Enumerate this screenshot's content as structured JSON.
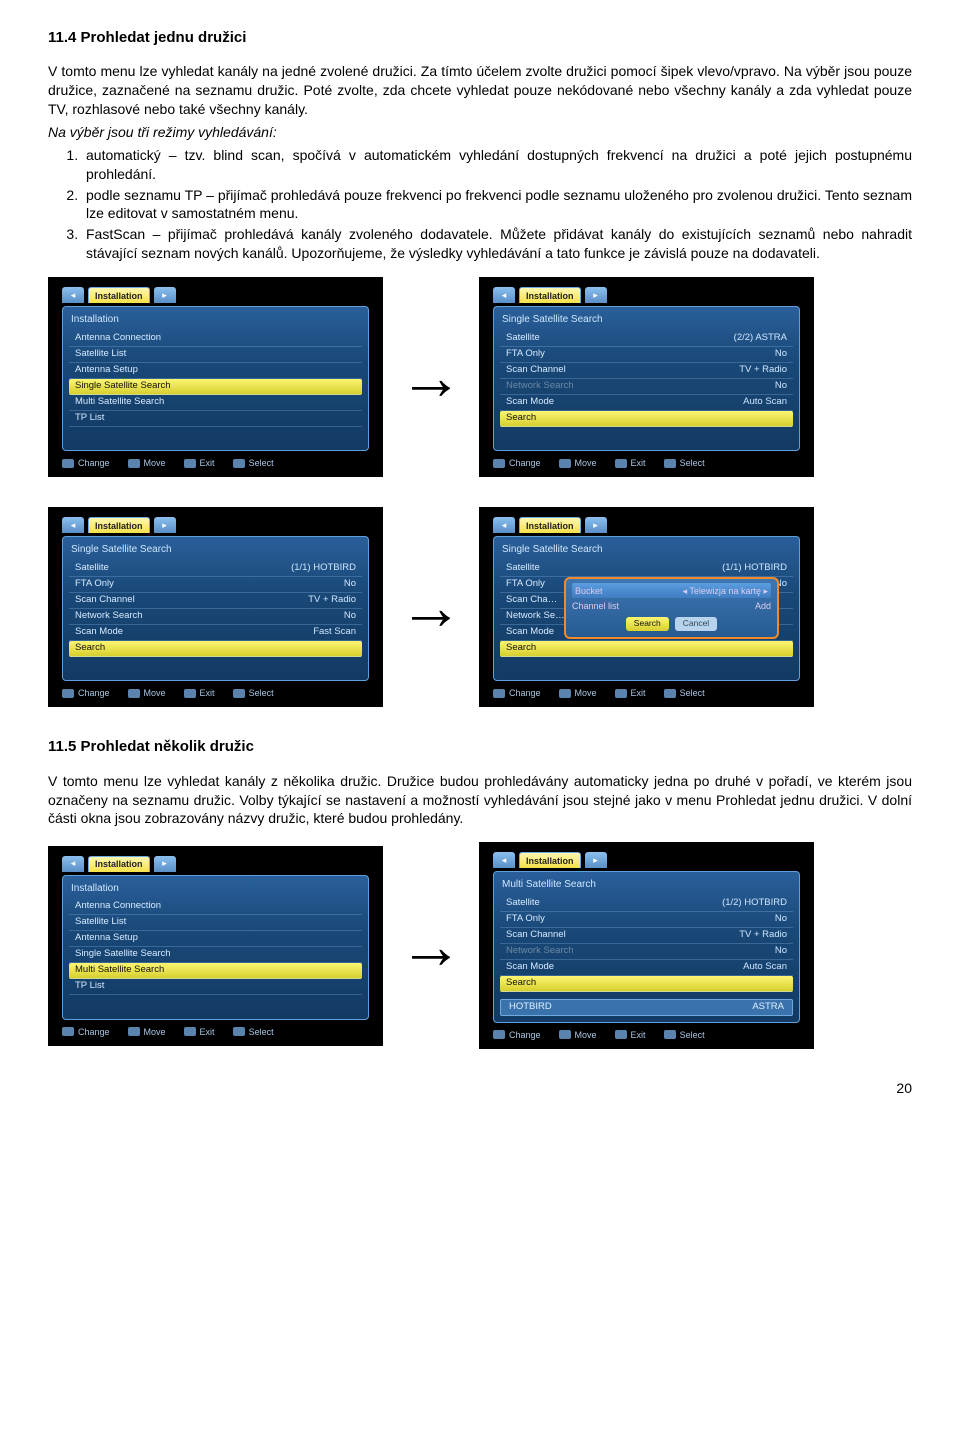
{
  "section1": {
    "heading": "11.4 Prohledat jednu družici",
    "p1": "V tomto menu lze vyhledat kanály na jedné zvolené družici. Za tímto účelem zvolte družici pomocí šipek vlevo/vpravo. Na výběr jsou pouze družice, zaznačené na seznamu družic. Poté zvolte, zda chcete vyhledat pouze nekódované nebo všechny kanály a zda vyhledat pouze TV, rozhlasové nebo také všechny kanály.",
    "modes_intro": "Na výběr jsou tři režimy vyhledávání:",
    "modes": [
      "automatický – tzv. blind scan, spočívá v automatickém vyhledání dostupných frekvencí na družici a poté jejich postupnému prohledání.",
      "podle seznamu TP – přijímač prohledává pouze frekvenci po frekvenci podle seznamu uloženého pro zvolenou družici. Tento seznam lze editovat v samostatném menu.",
      "FastScan – přijímač prohledává kanály zvoleného dodavatele. Můžete přidávat kanály do existujících seznamů nebo nahradit stávající seznam nových kanálů. Upozorňujeme, že výsledky vyhledávání a tato funkce je závislá pouze na dodavateli."
    ]
  },
  "section2": {
    "heading": "11.5 Prohledat několik družic",
    "p1": "V tomto menu lze vyhledat kanály z několika družic. Družice budou prohledávány automaticky jedna po druhé v pořadí, ve kterém jsou označeny na seznamu družic. Volby týkající se nastavení a možností vyhledávání jsou stejné jako v menu Prohledat jednu družici. V dolní části okna jsou zobrazovány názvy družic, které budou prohledány."
  },
  "ui": {
    "tab_label": "Installation",
    "hints": {
      "change": "Change",
      "move": "Move",
      "exit": "Exit",
      "select": "Select"
    },
    "arrow": "→",
    "installation_title": "Installation",
    "single_title": "Single Satellite Search",
    "multi_title": "Multi Satellite Search",
    "install_items": [
      "Antenna Connection",
      "Satellite List",
      "Antenna Setup",
      "Single Satellite Search",
      "Multi Satellite Search",
      "TP List"
    ],
    "labels": {
      "satellite": "Satellite",
      "fta": "FTA Only",
      "scanch": "Scan Channel",
      "netsearch": "Network Search",
      "scanmode": "Scan Mode",
      "search": "Search"
    },
    "s2": {
      "sat": "(2/2) ASTRA",
      "fta": "No",
      "scanch": "TV + Radio",
      "netsearch": "No",
      "scanmode": "Auto Scan"
    },
    "s3": {
      "sat": "(1/1) HOTBIRD",
      "fta": "No",
      "scanch": "TV + Radio",
      "netsearch": "No",
      "scanmode": "Fast Scan"
    },
    "s4": {
      "sat": "(1/1) HOTBIRD",
      "fta": "No",
      "popup": {
        "bucket_l": "Bucket",
        "bucket_r": "Telewizja na kartę",
        "chlist_l": "Channel list",
        "chlist_r": "Add",
        "btn_search": "Search",
        "btn_cancel": "Cancel"
      }
    },
    "s6": {
      "sat": "(1/2) HOTBIRD",
      "fta": "No",
      "scanch": "TV + Radio",
      "netsearch": "No",
      "scanmode": "Auto Scan",
      "list_l": "HOTBIRD",
      "list_r": "ASTRA"
    }
  },
  "page_number": "20"
}
